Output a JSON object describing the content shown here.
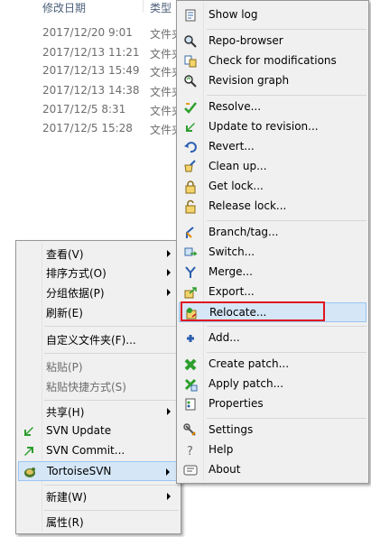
{
  "explorer": {
    "col_date": "修改日期",
    "col_type": "类型",
    "rows": [
      {
        "date": "2017/12/20 9:01",
        "type": "文件夹"
      },
      {
        "date": "2017/12/13 11:21",
        "type": "文件夹"
      },
      {
        "date": "2017/12/13 15:49",
        "type": "文件夹"
      },
      {
        "date": "2017/12/13 14:38",
        "type": "文件夹"
      },
      {
        "date": "2017/12/5 8:31",
        "type": "文件夹"
      },
      {
        "date": "2017/12/5 15:28",
        "type": "文件夹"
      }
    ]
  },
  "context_menu": {
    "view": "查看(V)",
    "sort": "排序方式(O)",
    "group": "分组依据(P)",
    "refresh": "刷新(E)",
    "customize": "自定义文件夹(F)...",
    "paste": "粘贴(P)",
    "paste_shortcut": "粘贴快捷方式(S)",
    "share": "共享(H)",
    "svn_update": "SVN Update",
    "svn_commit": "SVN Commit...",
    "tortoise": "TortoiseSVN",
    "new": "新建(W)",
    "properties": "属性(R)"
  },
  "svn_menu": {
    "show_log": "Show log",
    "repo_browser": "Repo-browser",
    "check_mods": "Check for modifications",
    "rev_graph": "Revision graph",
    "resolve": "Resolve...",
    "update_rev": "Update to revision...",
    "revert": "Revert...",
    "cleanup": "Clean up...",
    "get_lock": "Get lock...",
    "release_lock": "Release lock...",
    "branch_tag": "Branch/tag...",
    "switch": "Switch...",
    "merge": "Merge...",
    "export": "Export...",
    "relocate": "Relocate...",
    "add": "Add...",
    "create_patch": "Create patch...",
    "apply_patch": "Apply patch...",
    "properties": "Properties",
    "settings": "Settings",
    "help": "Help",
    "about": "About"
  },
  "colors": {
    "menu_bg": "#f0f0f0",
    "hover_bg": "#d5e6f7",
    "hover_border": "#99c7f2",
    "highlight_red": "#e0141e",
    "svn_green": "#2e9e2e"
  }
}
